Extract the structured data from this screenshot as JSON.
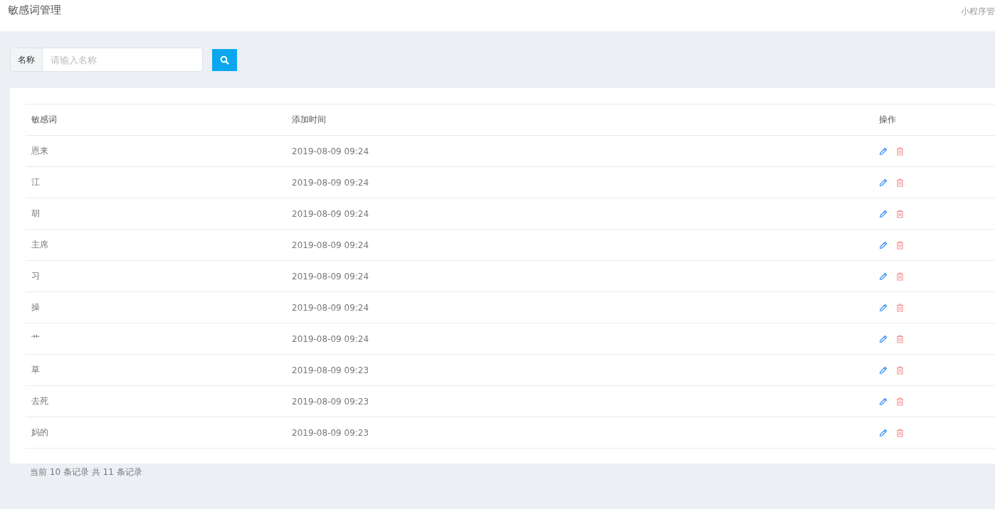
{
  "header": {
    "title": "敏感词管理",
    "breadcrumb": "小程序管"
  },
  "search": {
    "label": "名称",
    "placeholder": "请输入名称"
  },
  "table": {
    "columns": [
      "敏感词",
      "添加时间",
      "操作"
    ],
    "rows": [
      {
        "word": "恩来",
        "time": "2019-08-09 09:24"
      },
      {
        "word": "江",
        "time": "2019-08-09 09:24"
      },
      {
        "word": "胡",
        "time": "2019-08-09 09:24"
      },
      {
        "word": "主席",
        "time": "2019-08-09 09:24"
      },
      {
        "word": "习",
        "time": "2019-08-09 09:24"
      },
      {
        "word": "操",
        "time": "2019-08-09 09:24"
      },
      {
        "word": "艹",
        "time": "2019-08-09 09:24"
      },
      {
        "word": "草",
        "time": "2019-08-09 09:23"
      },
      {
        "word": "去死",
        "time": "2019-08-09 09:23"
      },
      {
        "word": "妈的",
        "time": "2019-08-09 09:23"
      }
    ]
  },
  "footer": "当前 10 条记录 共 11 条记录"
}
